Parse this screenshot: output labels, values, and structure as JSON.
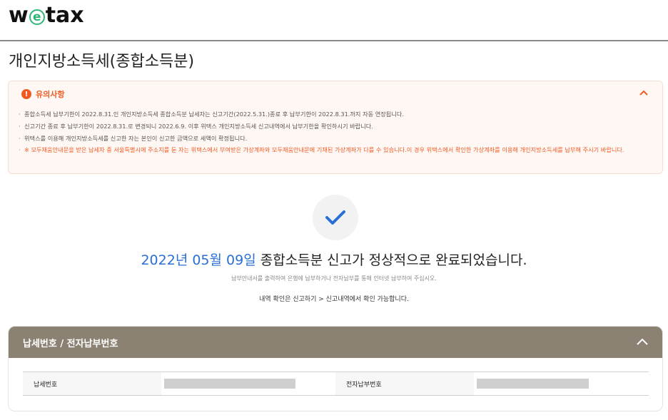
{
  "header": {
    "logo_pre": "w",
    "logo_e": "e",
    "logo_post": "tax"
  },
  "page": {
    "title": "개인지방소득세(종합소득분)"
  },
  "notice": {
    "title": "유의사항",
    "items": [
      "종합소득세 납부기한이 2022.8.31.인 개인지방소득세 종합소득분 납세자는 신고기간(2022.5.31.)종료 후 납부기한이 2022.8.31.까지 자동 연장됩니다.",
      "신고기간 종료 후 납부기한이 2022.8.31.로 변경되니 2022.6.9. 이후 위택스 개인지방소득세 신고내역에서 납부기한을 확인하시기 바랍니다.",
      "위택스를 이용해 개인지방소득세를 신고한 자는 본인이 신고한 금액으로 세액이 확정됩니다.",
      "※ 모두채움안내문을 받은 납세자 중 서울특별시에 주소지를 둔 자는 위택스에서 부여받은 가상계좌와 모두채움안내문에 기재된 가상계좌가 다를 수 있습니다.이 경우 위택스에서 확인한 가상계좌를 이용해 개인지방소득세를 납부해 주시기 바랍니다."
    ]
  },
  "completion": {
    "date": "2022년 05월 09일",
    "message": " 종합소득분 신고가 정상적으로 완료되었습니다.",
    "sub_message": "납부안내서를 출력하여 은행에 납부하거나 전자납부를 통해 인터넷 납부하여 주십시오.",
    "info_message": "내역 확인은 신고하기 > 신고내역에서 확인 가능합니다."
  },
  "payment": {
    "title": "납세번호 / 전자납부번호",
    "tax_number_label": "납세번호",
    "epay_number_label": "전자납부번호"
  },
  "colors": {
    "accent_orange": "#f05a22",
    "accent_blue": "#2a6fd6",
    "panel_brown": "#8c8274"
  }
}
